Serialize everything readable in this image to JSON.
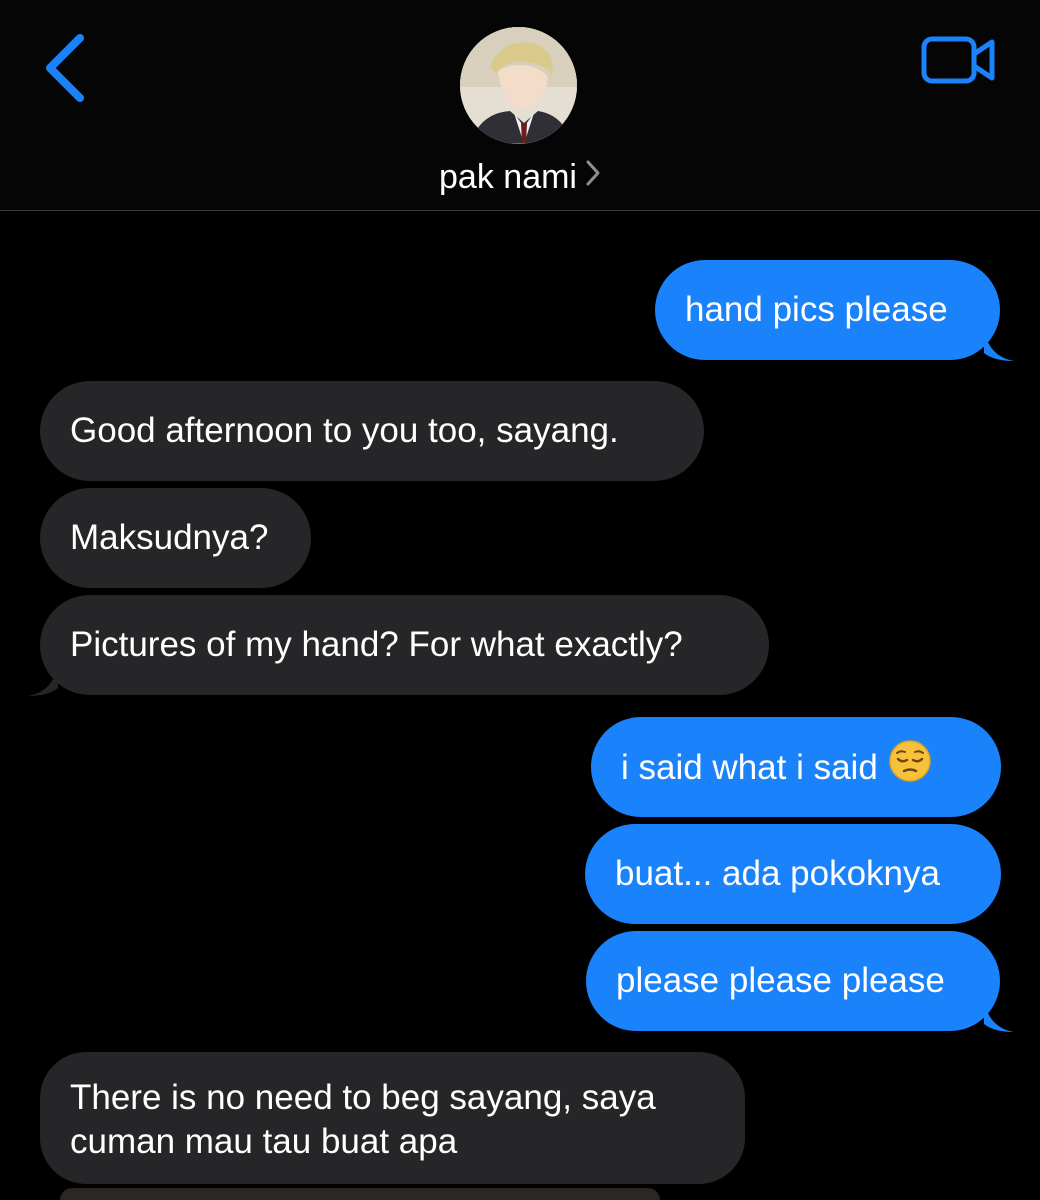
{
  "header": {
    "contact_name": "pak nami",
    "accent_color": "#1a82fb"
  },
  "icons": {
    "back": "chevron-left-icon",
    "video": "video-camera-icon",
    "name_chevron": "chevron-right-icon",
    "emoji": "pensive-face-emoji"
  },
  "messages": [
    {
      "direction": "outgoing",
      "text": "hand pics please"
    },
    {
      "direction": "incoming",
      "text": "Good afternoon to you too, sayang."
    },
    {
      "direction": "incoming",
      "text": "Maksudnya?"
    },
    {
      "direction": "incoming",
      "text": "Pictures of my hand? For what exactly?"
    },
    {
      "direction": "outgoing",
      "text": "i said what i said"
    },
    {
      "direction": "outgoing",
      "text": "buat... ada pokoknya"
    },
    {
      "direction": "outgoing",
      "text": "please please please"
    },
    {
      "direction": "incoming",
      "line1": "There is no need to beg sayang, saya",
      "line2": "cuman mau tau buat apa"
    }
  ],
  "colors": {
    "outgoing_bubble": "#1a82fb",
    "incoming_bubble": "#262628",
    "background": "#000000"
  }
}
